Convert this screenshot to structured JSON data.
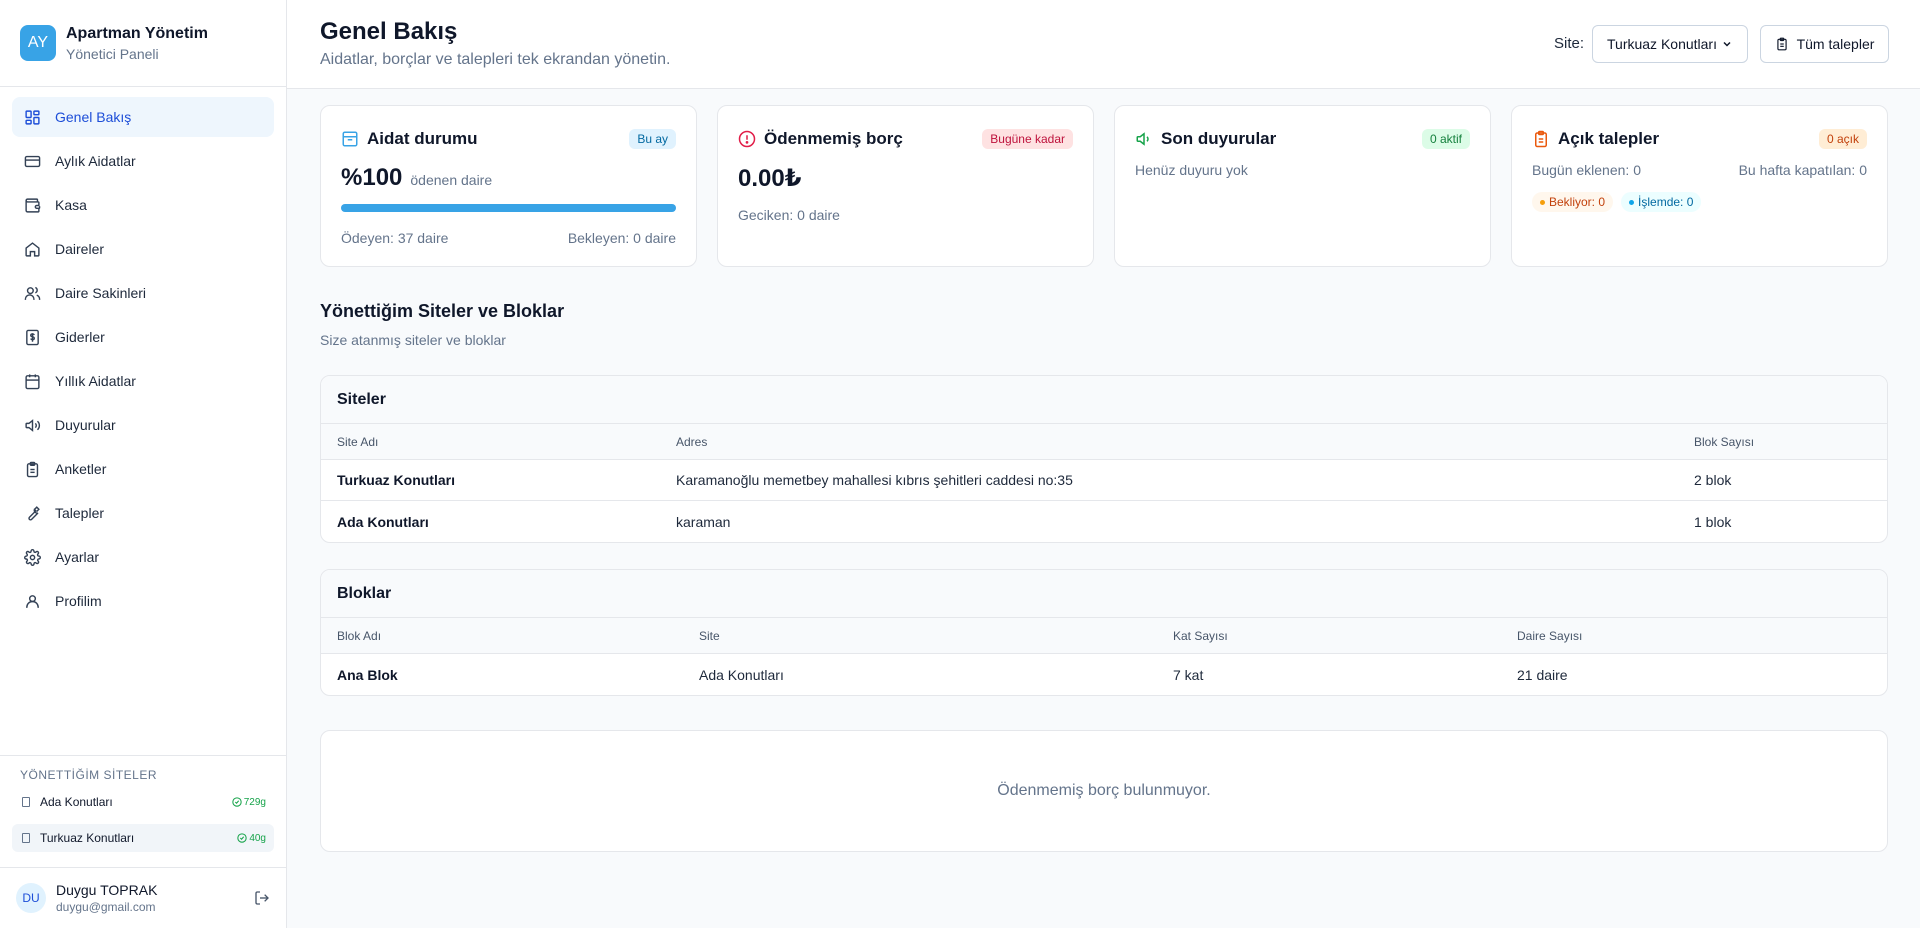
{
  "brand": {
    "initials": "AY",
    "title": "Apartman Yönetim",
    "subtitle": "Yönetici Paneli"
  },
  "nav": [
    {
      "label": "Genel Bakış",
      "icon": "grid-icon",
      "active": true
    },
    {
      "label": "Aylık Aidatlar",
      "icon": "card-icon"
    },
    {
      "label": "Kasa",
      "icon": "wallet-icon"
    },
    {
      "label": "Daireler",
      "icon": "home-icon"
    },
    {
      "label": "Daire Sakinleri",
      "icon": "users-icon"
    },
    {
      "label": "Giderler",
      "icon": "receipt-icon"
    },
    {
      "label": "Yıllık Aidatlar",
      "icon": "calendar-icon"
    },
    {
      "label": "Duyurular",
      "icon": "megaphone-icon"
    },
    {
      "label": "Anketler",
      "icon": "clipboard-icon"
    },
    {
      "label": "Talepler",
      "icon": "wrench-icon"
    },
    {
      "label": "Ayarlar",
      "icon": "gear-icon"
    },
    {
      "label": "Profilim",
      "icon": "user-icon"
    }
  ],
  "managed_sites": {
    "heading": "YÖNETTİĞİM SİTELER",
    "items": [
      {
        "name": "Ada Konutları",
        "badge": "729g"
      },
      {
        "name": "Turkuaz Konutları",
        "badge": "40g"
      }
    ]
  },
  "user": {
    "initials": "DU",
    "name": "Duygu TOPRAK",
    "email": "duygu@gmail.com"
  },
  "header": {
    "title": "Genel Bakış",
    "subtitle": "Aidatlar, borçlar ve talepleri tek ekrandan yönetin.",
    "site_label": "Site:",
    "site_value": "Turkuaz Konutları",
    "all_requests": "Tüm talepler"
  },
  "cards": {
    "dues": {
      "title": "Aidat durumu",
      "badge": "Bu ay",
      "value": "%100",
      "value_label": "ödenen daire",
      "progress": 1.0,
      "paid": "Ödeyen: 37 daire",
      "pending": "Bekleyen: 0 daire"
    },
    "debt": {
      "title": "Ödenmemiş borç",
      "badge": "Bugüne kadar",
      "value": "0.00₺",
      "late": "Geciken: 0 daire"
    },
    "announcements": {
      "title": "Son duyurular",
      "badge": "0 aktif",
      "empty": "Henüz duyuru yok"
    },
    "requests": {
      "title": "Açık talepler",
      "badge": "0 açık",
      "added_today": "Bugün eklenen: 0",
      "closed_week": "Bu hafta kapatılan: 0",
      "waiting": "Bekliyor: 0",
      "in_progress": "İşlemde: 0"
    }
  },
  "section": {
    "title": "Yönettiğim Siteler ve Bloklar",
    "subtitle": "Size atanmış siteler ve bloklar"
  },
  "sites_table": {
    "title": "Siteler",
    "columns": [
      "Site Adı",
      "Adres",
      "Blok Sayısı"
    ],
    "rows": [
      [
        "Turkuaz Konutları",
        "Karamanoğlu memetbey mahallesi kıbrıs şehitleri caddesi no:35",
        "2 blok"
      ],
      [
        "Ada Konutları",
        "karaman",
        "1 blok"
      ]
    ]
  },
  "blocks_table": {
    "title": "Bloklar",
    "columns": [
      "Blok Adı",
      "Site",
      "Kat Sayısı",
      "Daire Sayısı"
    ],
    "rows": [
      [
        "Ana Blok",
        "Ada Konutları",
        "7 kat",
        "21 daire"
      ]
    ]
  },
  "debt_empty": "Ödenmemiş borç bulunmuyor.",
  "colors": {
    "accent": "#38a3e6",
    "active_nav_bg": "#eef6fd",
    "active_nav_text": "#1d4ed8"
  }
}
